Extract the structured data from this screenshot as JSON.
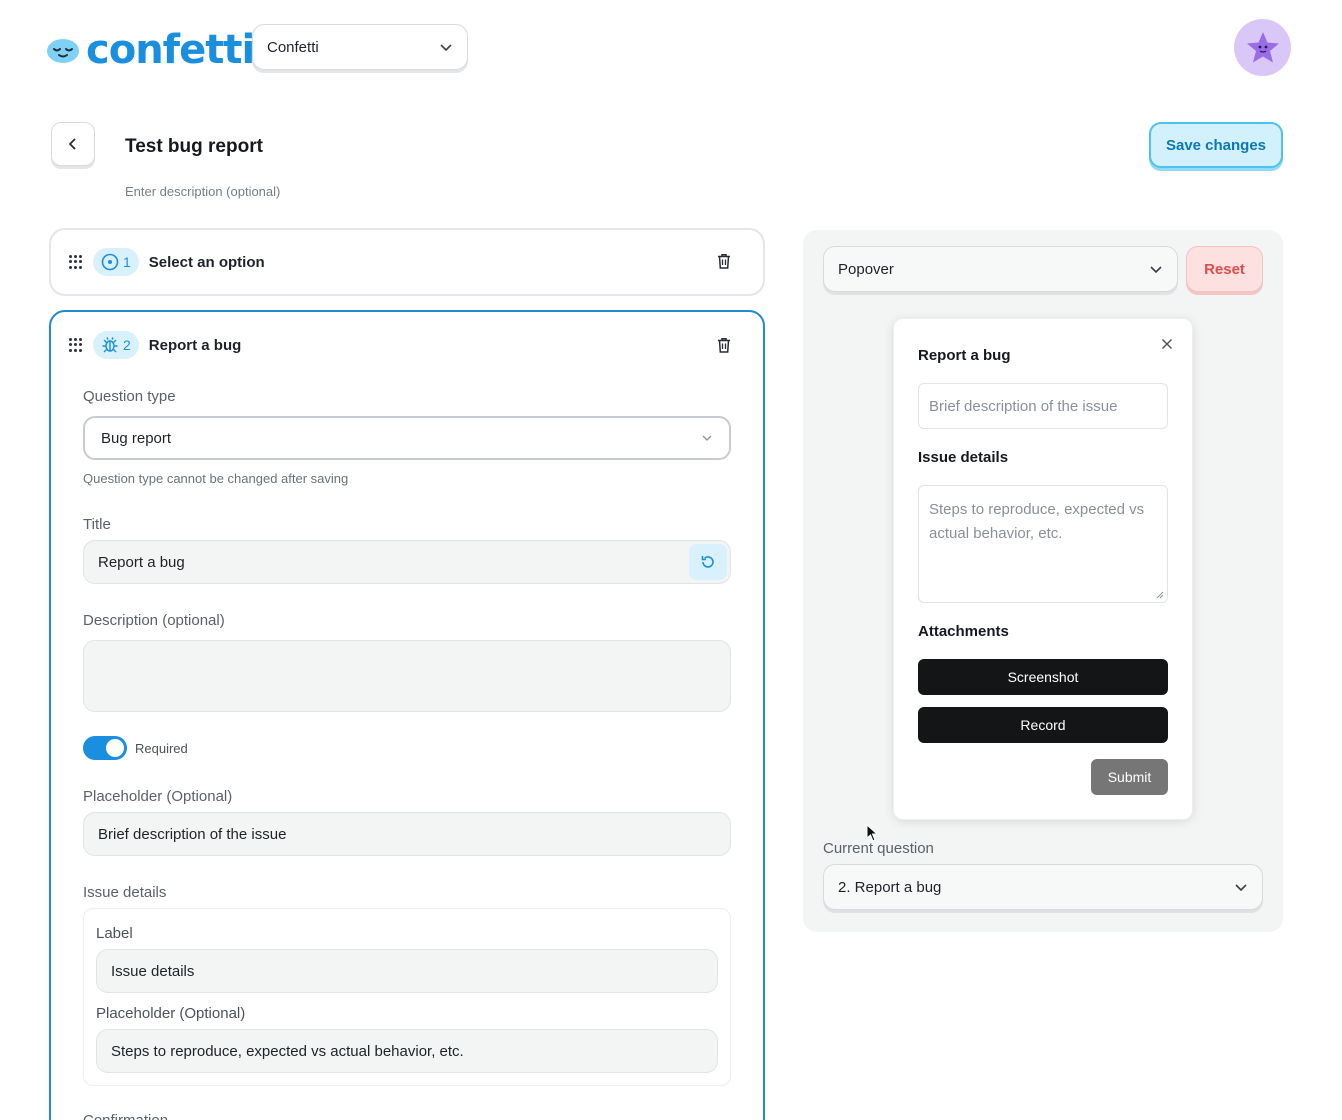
{
  "header": {
    "logo_text": "confetti",
    "workspace": "Confetti"
  },
  "page": {
    "title": "Test bug report",
    "description_placeholder": "Enter description (optional)",
    "save_label": "Save changes"
  },
  "questions": [
    {
      "number": "1",
      "title": "Select an option",
      "icon": "radio-icon"
    },
    {
      "number": "2",
      "title": "Report a bug",
      "icon": "bug-icon"
    }
  ],
  "editor": {
    "question_type_label": "Question type",
    "question_type_value": "Bug report",
    "question_type_hint": "Question type cannot be changed after saving",
    "title_label": "Title",
    "title_value": "Report a bug",
    "description_label": "Description (optional)",
    "required_label": "Required",
    "required": true,
    "placeholder_label": "Placeholder (Optional)",
    "placeholder_value": "Brief description of the issue",
    "issue_details_label": "Issue details",
    "issue_label_label": "Label",
    "issue_label_value": "Issue details",
    "issue_placeholder_label": "Placeholder (Optional)",
    "issue_placeholder_value": "Steps to reproduce, expected vs actual behavior, etc.",
    "next_section_partial": "Confirmation"
  },
  "preview": {
    "mode": "Popover",
    "reset_label": "Reset",
    "popover": {
      "title": "Report a bug",
      "input_placeholder": "Brief description of the issue",
      "details_label": "Issue details",
      "details_placeholder": "Steps to reproduce, expected vs actual behavior, etc.",
      "attachments_label": "Attachments",
      "screenshot_label": "Screenshot",
      "record_label": "Record",
      "submit_label": "Submit"
    },
    "current_question_label": "Current question",
    "current_question_value": "2. Report a bug"
  },
  "colors": {
    "brand": "#1a8fe0",
    "save_bg": "#d3f1fd",
    "reset_bg": "#fde1e1",
    "reset_text": "#e04b4b"
  }
}
